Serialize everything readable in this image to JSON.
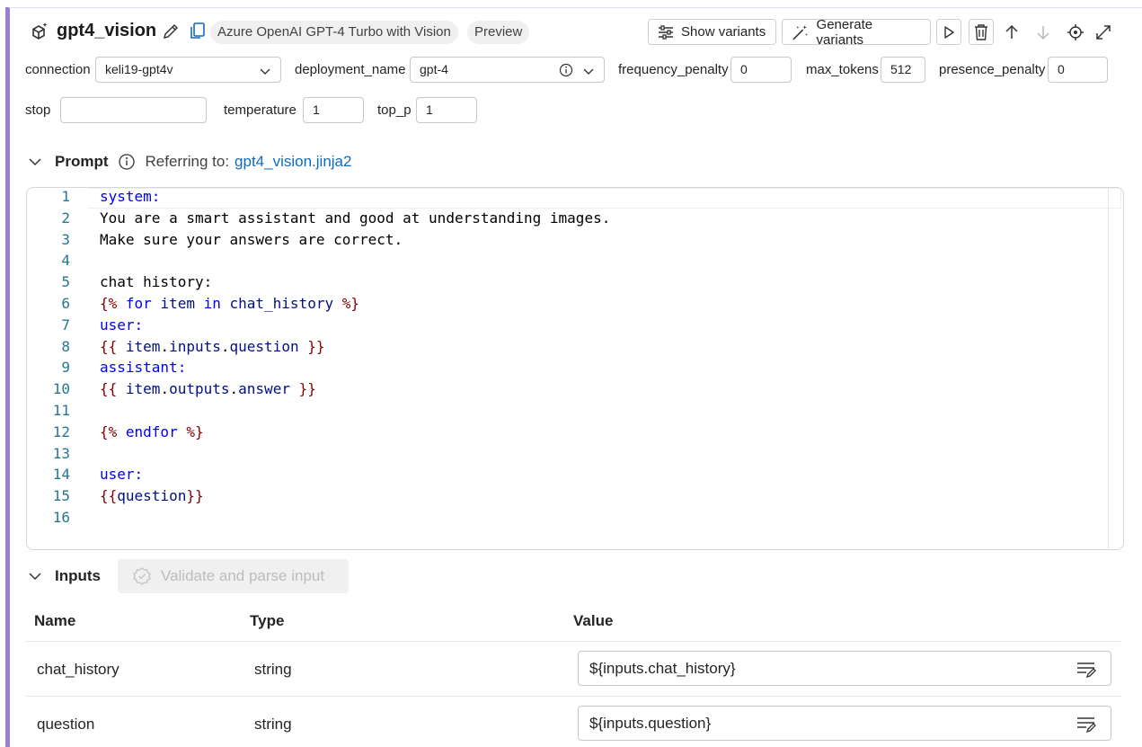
{
  "header": {
    "title": "gpt4_vision",
    "model_tag": "Azure OpenAI GPT-4 Turbo with Vision",
    "preview_tag": "Preview",
    "show_variants_label": "Show variants",
    "generate_variants_label": "Generate variants"
  },
  "params": {
    "connection": {
      "label": "connection",
      "value": "keli19-gpt4v"
    },
    "deployment_name": {
      "label": "deployment_name",
      "value": "gpt-4"
    },
    "frequency_penalty": {
      "label": "frequency_penalty",
      "value": "0"
    },
    "max_tokens": {
      "label": "max_tokens",
      "value": "512"
    },
    "presence_penalty": {
      "label": "presence_penalty",
      "value": "0"
    },
    "stop": {
      "label": "stop",
      "value": ""
    },
    "temperature": {
      "label": "temperature",
      "value": "1"
    },
    "top_p": {
      "label": "top_p",
      "value": "1"
    }
  },
  "prompt": {
    "section_title": "Prompt",
    "referring_label": "Referring to:",
    "file_link": "gpt4_vision.jinja2",
    "lines": [
      {
        "num": "1",
        "segments": [
          {
            "t": "system:",
            "c": "kw"
          }
        ]
      },
      {
        "num": "2",
        "segments": [
          {
            "t": "You are a smart assistant and good at understanding images.",
            "c": "plain"
          }
        ]
      },
      {
        "num": "3",
        "segments": [
          {
            "t": "Make sure your answers are correct.",
            "c": "plain"
          }
        ]
      },
      {
        "num": "4",
        "segments": []
      },
      {
        "num": "5",
        "segments": [
          {
            "t": "chat history:",
            "c": "plain"
          }
        ]
      },
      {
        "num": "6",
        "segments": [
          {
            "t": "{%",
            "c": "brace"
          },
          {
            "t": " for ",
            "c": "kw"
          },
          {
            "t": "item",
            "c": "var"
          },
          {
            "t": " in ",
            "c": "kw"
          },
          {
            "t": "chat_history",
            "c": "var"
          },
          {
            "t": " %}",
            "c": "brace"
          }
        ]
      },
      {
        "num": "7",
        "segments": [
          {
            "t": "user:",
            "c": "kw"
          }
        ]
      },
      {
        "num": "8",
        "segments": [
          {
            "t": "{{ ",
            "c": "brace"
          },
          {
            "t": "item",
            "c": "var"
          },
          {
            "t": ".",
            "c": "plain"
          },
          {
            "t": "inputs",
            "c": "var"
          },
          {
            "t": ".",
            "c": "plain"
          },
          {
            "t": "question",
            "c": "var"
          },
          {
            "t": " }}",
            "c": "brace"
          }
        ]
      },
      {
        "num": "9",
        "segments": [
          {
            "t": "assistant:",
            "c": "kw"
          }
        ]
      },
      {
        "num": "10",
        "segments": [
          {
            "t": "{{ ",
            "c": "brace"
          },
          {
            "t": "item",
            "c": "var"
          },
          {
            "t": ".",
            "c": "plain"
          },
          {
            "t": "outputs",
            "c": "var"
          },
          {
            "t": ".",
            "c": "plain"
          },
          {
            "t": "answer",
            "c": "var"
          },
          {
            "t": " }}",
            "c": "brace"
          }
        ]
      },
      {
        "num": "11",
        "segments": []
      },
      {
        "num": "12",
        "segments": [
          {
            "t": "{%",
            "c": "brace"
          },
          {
            "t": " endfor ",
            "c": "kw"
          },
          {
            "t": "%}",
            "c": "brace"
          }
        ]
      },
      {
        "num": "13",
        "segments": []
      },
      {
        "num": "14",
        "segments": [
          {
            "t": "user:",
            "c": "kw"
          }
        ]
      },
      {
        "num": "15",
        "segments": [
          {
            "t": "{{",
            "c": "brace"
          },
          {
            "t": "question",
            "c": "var"
          },
          {
            "t": "}}",
            "c": "brace"
          }
        ]
      },
      {
        "num": "16",
        "segments": []
      }
    ]
  },
  "inputs": {
    "section_title": "Inputs",
    "validate_label": "Validate and parse input",
    "columns": {
      "name": "Name",
      "type": "Type",
      "value": "Value"
    },
    "rows": [
      {
        "name": "chat_history",
        "type": "string",
        "value": "${inputs.chat_history}"
      },
      {
        "name": "question",
        "type": "string",
        "value": "${inputs.question}"
      }
    ]
  },
  "colors": {
    "accent": "#9b7fd1",
    "link": "#0f6cbd",
    "keyword": "#0000ff",
    "template_brace": "#800000",
    "variable": "#001080",
    "line_number": "#237893"
  }
}
